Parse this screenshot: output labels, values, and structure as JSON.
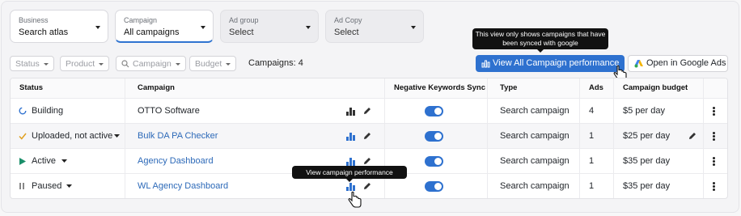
{
  "filters": {
    "business": {
      "label": "Business",
      "value": "Search atlas"
    },
    "campaign": {
      "label": "Campaign",
      "value": "All campaigns"
    },
    "ad_group": {
      "label": "Ad group",
      "value": "Select"
    },
    "ad_copy": {
      "label": "Ad Copy",
      "value": "Select"
    }
  },
  "chips": [
    "Status",
    "Product",
    "Campaign",
    "Budget"
  ],
  "campaign_count": "Campaigns: 4",
  "buttons": {
    "view_all": "View All Campaign performance",
    "open_google": "Open in Google Ads"
  },
  "tooltips": {
    "sync_note": "This view only shows campaigns that have been synced with google",
    "view_perf": "View campaign performance"
  },
  "columns": [
    "Status",
    "Campaign",
    "Negative Keywords Sync",
    "Type",
    "Ads",
    "Campaign budget"
  ],
  "rows": [
    {
      "status": "Building",
      "campaign": "OTTO Software",
      "type": "Search campaign",
      "ads": "4",
      "budget": "$5 per day",
      "sync": true
    },
    {
      "status": "Uploaded, not active",
      "campaign": "Bulk DA PA Checker",
      "type": "Search campaign",
      "ads": "1",
      "budget": "$25 per day",
      "sync": true
    },
    {
      "status": "Active",
      "campaign": "Agency Dashboard",
      "type": "Search campaign",
      "ads": "1",
      "budget": "$35 per day",
      "sync": true
    },
    {
      "status": "Paused",
      "campaign": "WL Agency Dashboard",
      "type": "Search campaign",
      "ads": "1",
      "budget": "$35 per day",
      "sync": true
    }
  ],
  "colors": {
    "accent": "#2e71cf",
    "link": "#2c69b8",
    "active": "#1a8f6a",
    "uploaded": "#e0a020"
  }
}
